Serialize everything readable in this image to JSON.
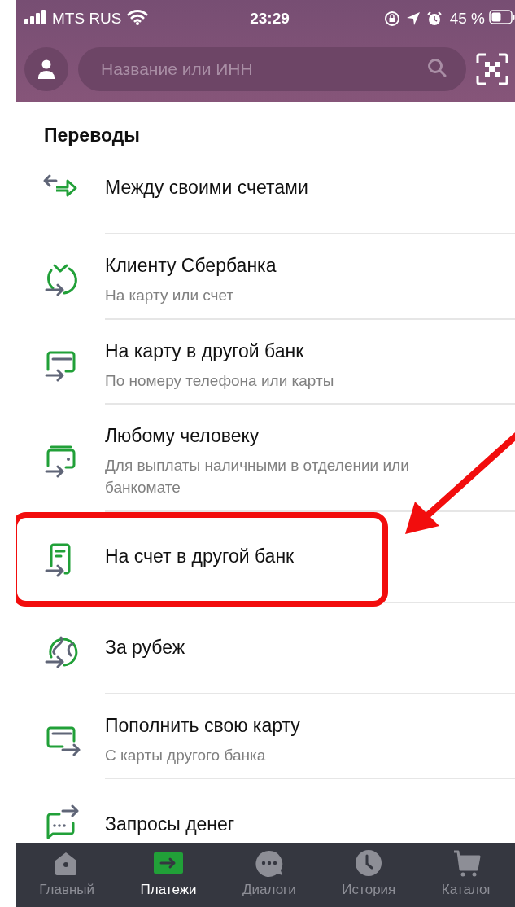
{
  "status_bar": {
    "carrier": "MTS RUS",
    "time": "23:29",
    "battery": "45 %"
  },
  "header": {
    "search": {
      "placeholder": "Название или ИНН"
    }
  },
  "section": {
    "title": "Переводы",
    "items": [
      {
        "kind": "swap",
        "title": "Между своими счетами",
        "highlighted": false
      },
      {
        "kind": "bank",
        "title": "Клиенту Сбербанка",
        "subtitle": "На карту или счет",
        "highlighted": false
      },
      {
        "kind": "card",
        "title": "На карту в другой банк",
        "subtitle": "По номеру телефона или карты",
        "highlighted": false
      },
      {
        "kind": "wallet",
        "title": "Любому человеку",
        "subtitle": "Для выплаты наличными в отделении или банкомате",
        "highlighted": false
      },
      {
        "kind": "document",
        "title": "На счет в другой банк",
        "highlighted": true
      },
      {
        "kind": "globe",
        "title": "За рубеж",
        "highlighted": false
      },
      {
        "kind": "topup",
        "title": "Пополнить свою карту",
        "subtitle": "С карты другого банка",
        "highlighted": false
      },
      {
        "kind": "request",
        "title": "Запросы денег",
        "highlighted": false
      }
    ]
  },
  "tabs": [
    {
      "kind": "home",
      "label": "Главный",
      "selected": false
    },
    {
      "kind": "payments",
      "label": "Платежи",
      "selected": true
    },
    {
      "kind": "chat",
      "label": "Диалоги",
      "selected": false
    },
    {
      "kind": "clock",
      "label": "История",
      "selected": false
    },
    {
      "kind": "cart",
      "label": "Каталог",
      "selected": false
    }
  ]
}
